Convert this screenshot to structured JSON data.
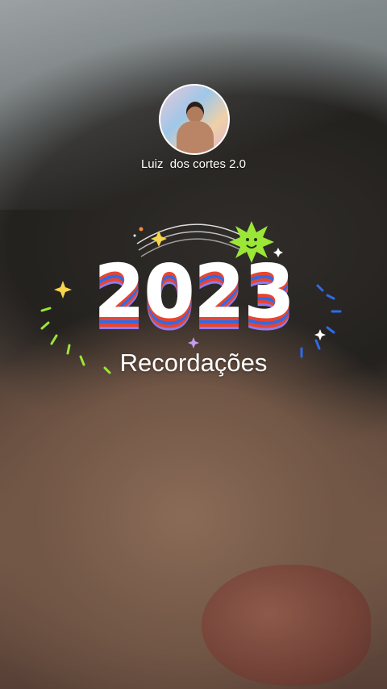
{
  "story": {
    "author": {
      "name": "Luiz  dos cortes 2.0",
      "avatar_icon": "profile-photo"
    },
    "title": {
      "year": "2023",
      "subtitle": "Recordações"
    },
    "colors": {
      "red": "#e8442f",
      "blue": "#2f6be8",
      "purple": "#8d7bf0",
      "green": "#9be636",
      "yellow": "#f6d54b"
    }
  }
}
